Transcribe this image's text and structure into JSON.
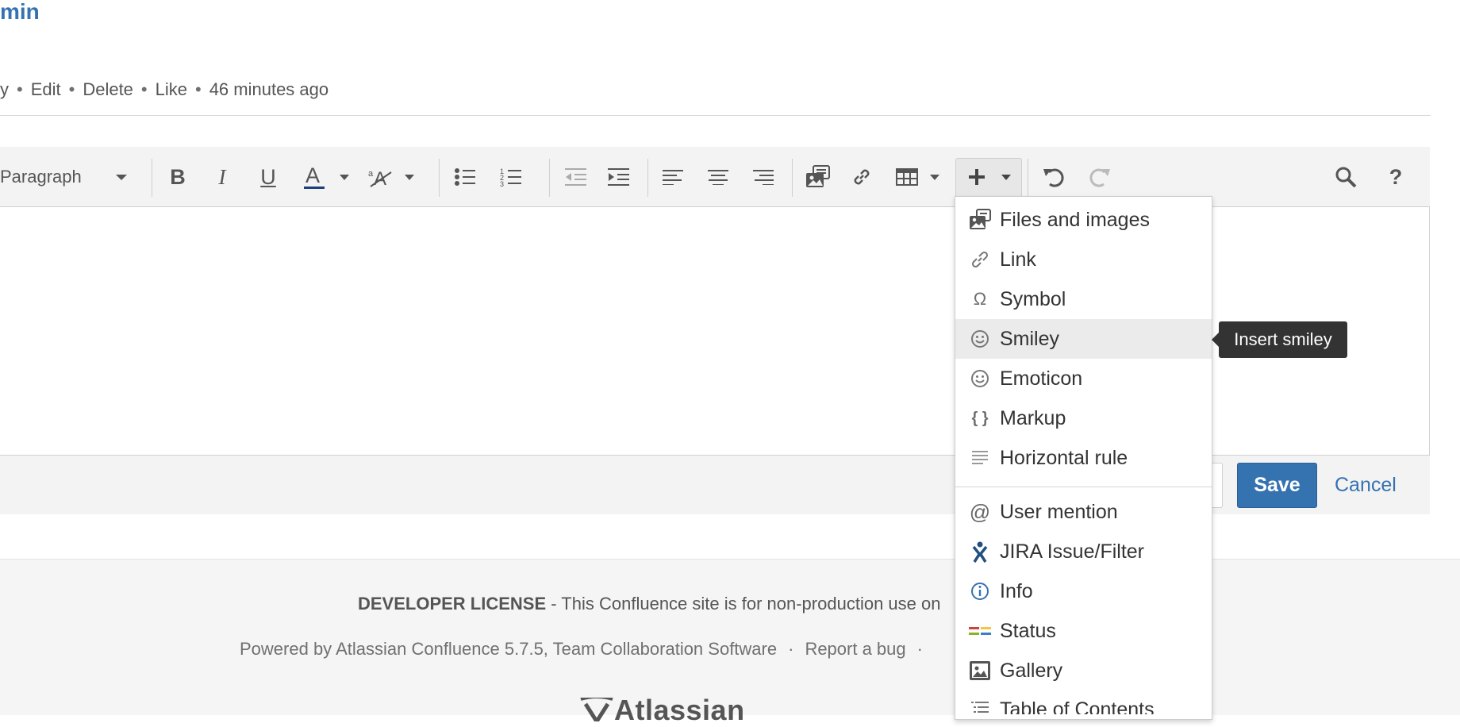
{
  "author": {
    "name_fragment": "min"
  },
  "comment_meta": {
    "items": [
      "y",
      "Edit",
      "Delete",
      "Like",
      "46 minutes ago"
    ]
  },
  "toolbar": {
    "paragraph_label": "Paragraph",
    "icons": [
      "bold-icon",
      "italic-icon",
      "underline-icon",
      "text-color-icon",
      "formatting-icon",
      "bullet-list-icon",
      "numbered-list-icon",
      "outdent-icon",
      "indent-icon",
      "align-left-icon",
      "align-center-icon",
      "align-right-icon",
      "image-icon",
      "link-icon",
      "table-icon",
      "insert-plus-icon",
      "undo-icon",
      "redo-icon",
      "search-icon",
      "help-icon"
    ]
  },
  "insert_menu": {
    "items": [
      {
        "label": "Files and images",
        "icon": "files-images-icon"
      },
      {
        "label": "Link",
        "icon": "link-icon"
      },
      {
        "label": "Symbol",
        "icon": "omega-icon"
      },
      {
        "label": "Smiley",
        "icon": "smiley-icon"
      },
      {
        "label": "Emoticon",
        "icon": "emoticon-icon"
      },
      {
        "label": "Markup",
        "icon": "markup-icon"
      },
      {
        "label": "Horizontal rule",
        "icon": "horizontal-rule-icon"
      },
      {
        "label": "User mention",
        "icon": "at-icon"
      },
      {
        "label": "JIRA Issue/Filter",
        "icon": "jira-icon"
      },
      {
        "label": "Info",
        "icon": "info-icon"
      },
      {
        "label": "Status",
        "icon": "status-icon"
      },
      {
        "label": "Gallery",
        "icon": "gallery-icon"
      },
      {
        "label": "Table of Contents",
        "icon": "toc-icon"
      }
    ],
    "hovered": "Smiley"
  },
  "tooltip": {
    "text": "Insert smiley"
  },
  "buttons": {
    "save": "Save",
    "cancel": "Cancel"
  },
  "footer": {
    "license_bold": "DEVELOPER LICENSE",
    "license_rest": " - This Confluence site is for non-production use on",
    "powered": "Powered by Atlassian Confluence 5.7.5, Team Collaboration Software",
    "report_bug": "Report a bug",
    "dot": "·",
    "logo_text": "Atlassian"
  },
  "colors": {
    "link_blue": "#3572b0",
    "toolbar_bg": "#f3f3f3",
    "tooltip_bg": "#333333",
    "hover_bg": "#ebebeb"
  }
}
